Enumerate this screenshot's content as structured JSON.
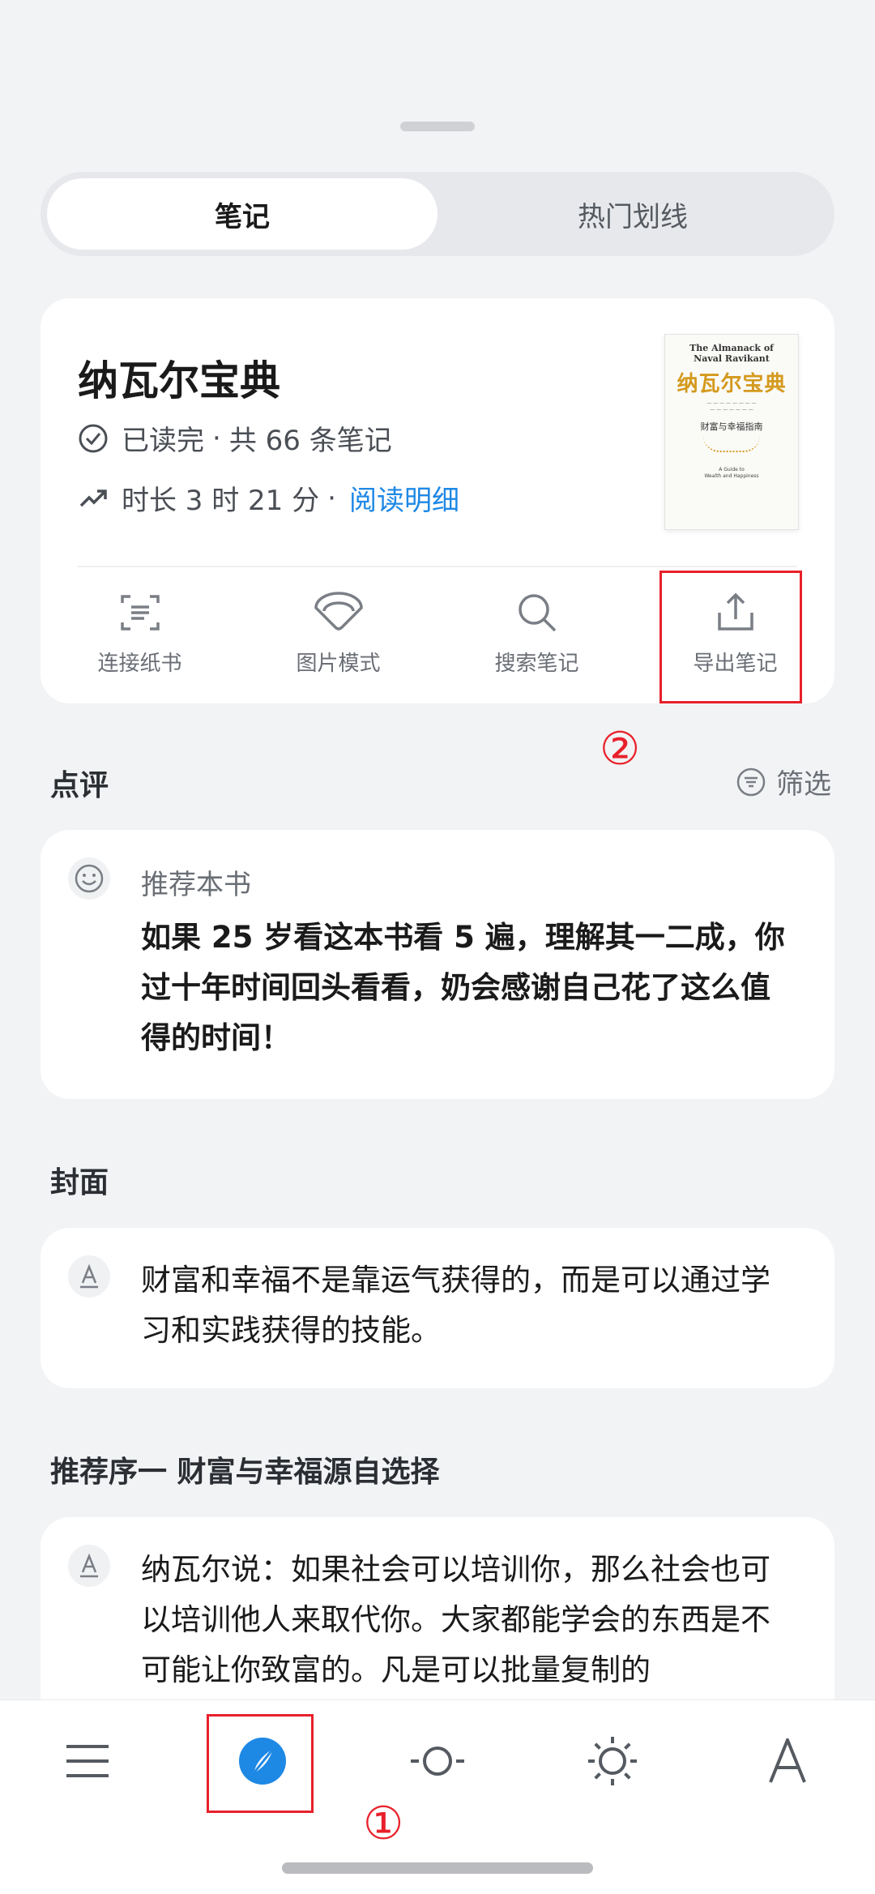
{
  "tabs": [
    {
      "label": "笔记",
      "active": true
    },
    {
      "label": "热门划线",
      "active": false
    }
  ],
  "book": {
    "title": "纳瓦尔宝典",
    "status": "已读完",
    "notes_count_text": "共 66 条笔记",
    "duration_text": "时长 3 时 21 分",
    "detail_link": "阅读明细",
    "cover": {
      "en_title_1": "The Almanack of",
      "en_title_2": "Naval Ravikant",
      "cn_title": "纳瓦尔宝典",
      "sub": "财富与幸福指南",
      "guide_1": "A Guide to",
      "guide_2": "Wealth and Happiness"
    }
  },
  "actions": [
    {
      "label": "连接纸书",
      "icon": "scan-icon"
    },
    {
      "label": "图片模式",
      "icon": "fan-icon"
    },
    {
      "label": "搜索笔记",
      "icon": "search-icon"
    },
    {
      "label": "导出笔记",
      "icon": "export-icon"
    }
  ],
  "annotations": {
    "n1": "①",
    "n2": "②"
  },
  "review_section": {
    "title": "点评",
    "filter_label": "筛选",
    "card": {
      "label": "推荐本书",
      "text": "如果 25 岁看这本书看 5 遍，理解其一二成，你过十年时间回头看看，奶会感谢自己花了这么值得的时间！"
    }
  },
  "cover_section": {
    "title": "封面",
    "card": {
      "text": "财富和幸福不是靠运气获得的，而是可以通过学习和实践获得的技能。"
    }
  },
  "preface_section": {
    "title": "推荐序一 财富与幸福源自选择",
    "card": {
      "text": "纳瓦尔说：如果社会可以培训你，那么社会也可以培训他人来取代你。大家都能学会的东西是不可能让你致富的。凡是可以批量复制的"
    }
  },
  "bottom_bar": [
    {
      "icon": "menu-icon"
    },
    {
      "icon": "compass-icon",
      "active": true
    },
    {
      "icon": "progress-icon"
    },
    {
      "icon": "brightness-icon"
    },
    {
      "icon": "font-icon",
      "label": "A"
    }
  ],
  "colors": {
    "accent": "#1e88e5",
    "annotation": "#e8202a",
    "background": "#f2f3f5"
  }
}
